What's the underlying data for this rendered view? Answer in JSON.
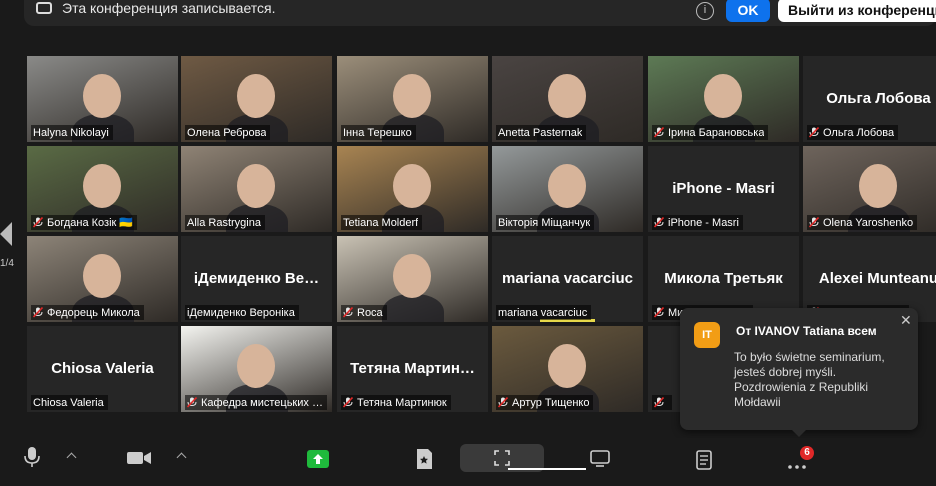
{
  "banner": {
    "recording_text": "Эта конференция записывается.",
    "ok_label": "OK",
    "leave_label": "Выйти из конференции"
  },
  "gallery": {
    "page_label": "1/4",
    "tiles": [
      {
        "name": "Halyna Nikolayi",
        "muted": false,
        "video": true,
        "bg": "#8a8a88"
      },
      {
        "name": "Олена Реброва",
        "muted": false,
        "video": true,
        "bg": "#6f5a44",
        "active": true
      },
      {
        "name": "Інна Терешко",
        "muted": false,
        "video": true,
        "bg": "#9b8e7a"
      },
      {
        "name": "Anetta Pasternak",
        "muted": false,
        "video": true,
        "bg": "#4a4442"
      },
      {
        "name": "Ірина Барановська",
        "muted": true,
        "video": true,
        "bg": "#5d7a55"
      },
      {
        "name": "Ольга Лобова",
        "muted": true,
        "video": false
      },
      {
        "name": "Богдана Козік 🇺🇦",
        "muted": true,
        "video": true,
        "bg": "#5a6b45"
      },
      {
        "name": "Alla Rastrygina",
        "muted": false,
        "video": true,
        "bg": "#8f8375"
      },
      {
        "name": "Tetiana Molderf",
        "muted": false,
        "video": true,
        "bg": "#a88452"
      },
      {
        "name": "Вікторія Міщанчук",
        "muted": false,
        "video": true,
        "bg": "#94999a"
      },
      {
        "name": "iPhone - Masri",
        "muted": true,
        "video": false
      },
      {
        "name": "Olena Yaroshenko",
        "muted": true,
        "video": true,
        "bg": "#6e645c"
      },
      {
        "name": "Федорець Микола",
        "muted": true,
        "video": true,
        "bg": "#8d8478"
      },
      {
        "name": "iДемиденко Вероніка",
        "big": "iДемиденко Ве…",
        "muted": false,
        "video": false
      },
      {
        "name": "Roca",
        "muted": true,
        "video": true,
        "bg": "#c9c2b4"
      },
      {
        "name": "mariana vacarciuc",
        "muted": false,
        "video": false,
        "speaking": true
      },
      {
        "name": "Микола Третьяк",
        "muted": true,
        "video": false
      },
      {
        "name": "Alexei Munteanu",
        "big": "Alexei Munteanu",
        "muted": true,
        "video": false
      },
      {
        "name": "Chiosa Valeria",
        "muted": false,
        "video": false
      },
      {
        "name": "Кафедра мистецьких …",
        "muted": true,
        "video": true,
        "bg": "#f4f4f0"
      },
      {
        "name": "Тетяна Мартинюк",
        "big": "Тетяна Мартин…",
        "muted": true,
        "video": false
      },
      {
        "name": "Артур Тищенко",
        "muted": true,
        "video": true,
        "bg": "#6b5a3e"
      },
      {
        "name": "",
        "muted": true,
        "video": false
      }
    ]
  },
  "toast": {
    "avatar_initials": "IT",
    "title": "От IVANOV Tatiana всем",
    "message": "To było świetne seminarium, jesteś dobrej myśli. Pozdrowienia z Republiki Mołdawii"
  },
  "toolbar": {
    "more_badge": "6"
  },
  "colors": {
    "active_speaker": "#a6e25a",
    "primary_blue": "#0e72ed",
    "share_green": "#1fba3c",
    "badge_red": "#e02828",
    "avatar_orange": "#f29d15"
  }
}
